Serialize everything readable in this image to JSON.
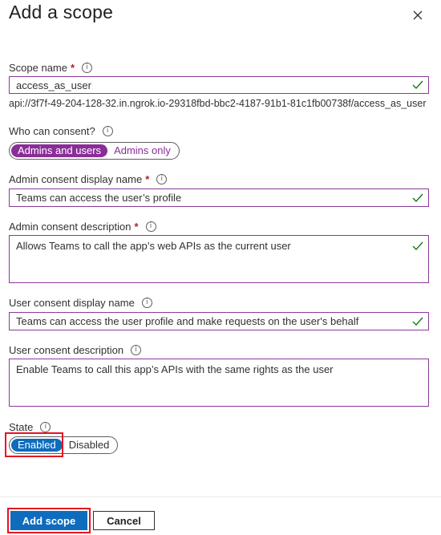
{
  "title": "Add a scope",
  "fields": {
    "scope_name": {
      "label": "Scope name",
      "value": "access_as_user",
      "hint": "api://3f7f-49-204-128-32.in.ngrok.io-29318fbd-bbc2-4187-91b1-81c1fb00738f/access_as_user"
    },
    "who_can_consent": {
      "label": "Who can consent?",
      "options": [
        "Admins and users",
        "Admins only"
      ],
      "selected": "Admins and users"
    },
    "admin_display_name": {
      "label": "Admin consent display name",
      "value": "Teams can access the user’s profile"
    },
    "admin_description": {
      "label": "Admin consent description",
      "value": "Allows Teams to call the app’s web APIs as the current user"
    },
    "user_display_name": {
      "label": "User consent display name",
      "value": "Teams can access the user profile and make requests on the user's behalf"
    },
    "user_description": {
      "label": "User consent description",
      "value": "Enable Teams to call this app’s APIs with the same rights as the user"
    },
    "state": {
      "label": "State",
      "options": [
        "Enabled",
        "Disabled"
      ],
      "selected": "Enabled"
    }
  },
  "buttons": {
    "add": "Add scope",
    "cancel": "Cancel"
  },
  "colors": {
    "accent_purple": "#8a2d98",
    "primary_blue": "#0f6cbd",
    "valid_green": "#107c10",
    "highlight_red": "#e81123",
    "required_red": "#a4262c"
  }
}
